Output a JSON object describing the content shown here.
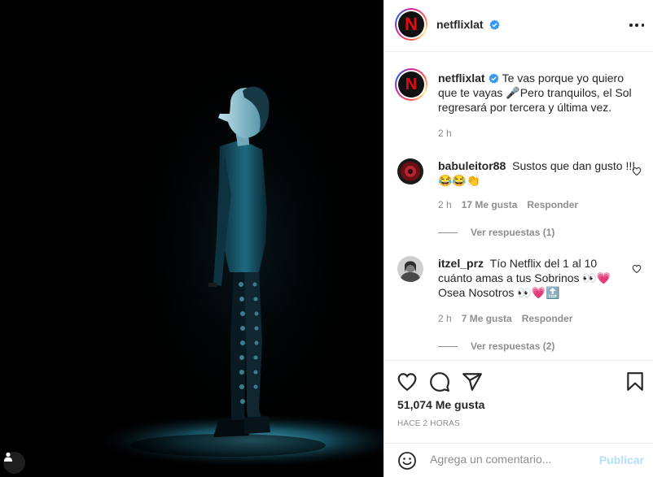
{
  "post": {
    "author": "netflixlat",
    "caption": "Te vas porque yo quiero que te vayas 🎤Pero tranquilos, el Sol regresará por tercera y última vez.",
    "caption_time": "2 h",
    "avatar_letter": "N"
  },
  "comments": [
    {
      "user": "babuleitor88",
      "text": "Sustos que dan gusto !!! 😂😂👏",
      "time": "2 h",
      "likes": "17 Me gusta",
      "reply": "Responder",
      "view_replies": "Ver respuestas (1)"
    },
    {
      "user": "itzel_prz",
      "text": "Tío Netflix del 1 al 10 cuánto amas a tus Sobrinos 👀💗 Osea Nosotros 👀💗🔝",
      "time": "2 h",
      "likes": "7 Me gusta",
      "reply": "Responder",
      "view_replies": "Ver respuestas (2)"
    }
  ],
  "stats": {
    "likes": "51,074 Me gusta",
    "ago": "HACE 2 HORAS"
  },
  "composer": {
    "placeholder": "Agrega un comentario...",
    "publish": "Publicar"
  },
  "icons": {
    "more": "more-options-icon",
    "like": "heart-icon",
    "comment": "comment-icon",
    "share": "share-icon",
    "save": "bookmark-icon",
    "emoji": "emoji-icon",
    "tagged": "user-tag-icon",
    "verified": "verified-badge-icon"
  },
  "colors": {
    "verified": "#3897f0",
    "publish_disabled": "#b2dffc",
    "netflix_red": "#e50914"
  }
}
